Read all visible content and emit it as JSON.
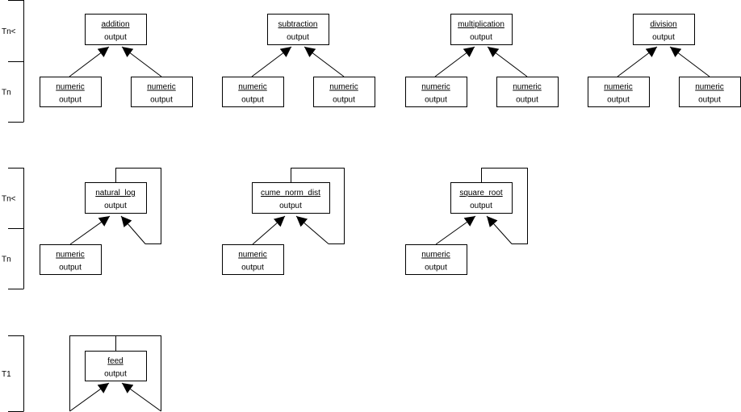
{
  "colors": {
    "line": "#000000",
    "box_fill": "#ffffff",
    "background": "#ffffff"
  },
  "rows": [
    {
      "levels": [
        "Tn<",
        "Tn"
      ],
      "diagrams": [
        {
          "operator": "addition",
          "operator_output": "output",
          "inputs": [
            {
              "name": "numeric",
              "output": "output"
            },
            {
              "name": "numeric",
              "output": "output"
            }
          ],
          "self_loop": false
        },
        {
          "operator": "subtraction",
          "operator_output": "output",
          "inputs": [
            {
              "name": "numeric",
              "output": "output"
            },
            {
              "name": "numeric",
              "output": "output"
            }
          ],
          "self_loop": false
        },
        {
          "operator": "multiplication",
          "operator_output": "output",
          "inputs": [
            {
              "name": "numeric",
              "output": "output"
            },
            {
              "name": "numeric",
              "output": "output"
            }
          ],
          "self_loop": false
        },
        {
          "operator": "division",
          "operator_output": "output",
          "inputs": [
            {
              "name": "numeric",
              "output": "output"
            },
            {
              "name": "numeric",
              "output": "output"
            }
          ],
          "self_loop": false
        }
      ]
    },
    {
      "levels": [
        "Tn<",
        "Tn"
      ],
      "diagrams": [
        {
          "operator": "natural_log",
          "operator_output": "output",
          "inputs": [
            {
              "name": "numeric",
              "output": "output"
            }
          ],
          "self_loop": true
        },
        {
          "operator": "cume_norm_dist",
          "operator_output": "output",
          "inputs": [
            {
              "name": "numeric",
              "output": "output"
            }
          ],
          "self_loop": true
        },
        {
          "operator": "square_root",
          "operator_output": "output",
          "inputs": [
            {
              "name": "numeric",
              "output": "output"
            }
          ],
          "self_loop": true
        }
      ]
    },
    {
      "levels": [
        "T1"
      ],
      "diagrams": [
        {
          "operator": "feed",
          "operator_output": "output",
          "inputs": [],
          "self_loop": "double"
        }
      ]
    }
  ]
}
